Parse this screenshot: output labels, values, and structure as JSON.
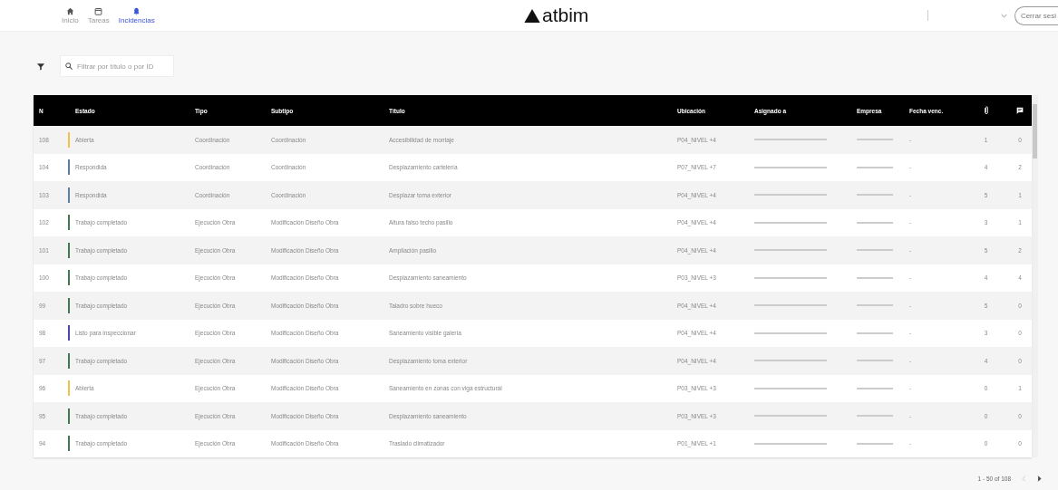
{
  "nav": [
    {
      "label": "Inicio",
      "kind": "home",
      "selected": false
    },
    {
      "label": "Tareas",
      "kind": "calendar",
      "selected": false
    },
    {
      "label": "Incidencias",
      "kind": "bell",
      "selected": true
    }
  ],
  "logo": "atbim",
  "logout": "Cerrar sesi",
  "search": {
    "placeholder": "Filtrar por título o por ID"
  },
  "table": {
    "columns": [
      "N",
      "Estado",
      "Tipo",
      "Subtipo",
      "Título",
      "Ubicación",
      "Asignado a",
      "Empresa",
      "Fecha venc."
    ],
    "rows": [
      {
        "id": "108",
        "status": "Abierta",
        "color": "#f0c24a",
        "type": "Coordinación",
        "subtype": "Coordinación",
        "title": "Accesibilidad de montaje",
        "location": "P04_NIVEL +4",
        "due": "-",
        "files": "1",
        "comments": "0"
      },
      {
        "id": "104",
        "status": "Respondida",
        "color": "#5a7fa6",
        "type": "Coordinación",
        "subtype": "Coordinación",
        "title": "Desplazamiento cartelería",
        "location": "P07_NIVEL +7",
        "due": "-",
        "files": "4",
        "comments": "2"
      },
      {
        "id": "103",
        "status": "Respondida",
        "color": "#5a7fa6",
        "type": "Coordinación",
        "subtype": "Coordinación",
        "title": "Desplazar toma exterior",
        "location": "P04_NIVEL +4",
        "due": "-",
        "files": "5",
        "comments": "1"
      },
      {
        "id": "102",
        "status": "Trabajo completado",
        "color": "#3d7a4e",
        "type": "Ejecución Obra",
        "subtype": "Modificación Diseño Obra",
        "title": "Altura falso techo pasillo",
        "location": "P04_NIVEL +4",
        "due": "-",
        "files": "3",
        "comments": "1"
      },
      {
        "id": "101",
        "status": "Trabajo completado",
        "color": "#3d7a4e",
        "type": "Ejecución Obra",
        "subtype": "Modificación Diseño Obra",
        "title": "Ampliación pasillo",
        "location": "P04_NIVEL +4",
        "due": "-",
        "files": "5",
        "comments": "2"
      },
      {
        "id": "100",
        "status": "Trabajo completado",
        "color": "#3d7a4e",
        "type": "Ejecución Obra",
        "subtype": "Modificación Diseño Obra",
        "title": "Desplazamiento saneamiento",
        "location": "P03_NIVEL +3",
        "due": "-",
        "files": "4",
        "comments": "4"
      },
      {
        "id": "99",
        "status": "Trabajo completado",
        "color": "#3d7a4e",
        "type": "Ejecución Obra",
        "subtype": "Modificación Diseño Obra",
        "title": "Taladro sobre hueco",
        "location": "P04_NIVEL +4",
        "due": "-",
        "files": "5",
        "comments": "0"
      },
      {
        "id": "98",
        "status": "Listo para inspeccionar",
        "color": "#4a3fd4",
        "type": "Ejecución Obra",
        "subtype": "Modificación Diseño Obra",
        "title": "Saneamiento visible galería",
        "location": "P04_NIVEL +4",
        "due": "-",
        "files": "3",
        "comments": "0"
      },
      {
        "id": "97",
        "status": "Trabajo completado",
        "color": "#3d7a4e",
        "type": "Ejecución Obra",
        "subtype": "Modificación Diseño Obra",
        "title": "Desplazamiento toma exterior",
        "location": "P04_NIVEL +4",
        "due": "-",
        "files": "4",
        "comments": "0"
      },
      {
        "id": "96",
        "status": "Abierta",
        "color": "#f0c24a",
        "type": "Ejecución Obra",
        "subtype": "Modificación Diseño Obra",
        "title": "Saneamiento en zonas con viga estructural",
        "location": "P03_NIVEL +3",
        "due": "-",
        "files": "0",
        "comments": "1"
      },
      {
        "id": "95",
        "status": "Trabajo completado",
        "color": "#3d7a4e",
        "type": "Ejecución Obra",
        "subtype": "Modificación Diseño Obra",
        "title": "Desplazamiento saneamiento",
        "location": "P03_NIVEL +3",
        "due": "-",
        "files": "0",
        "comments": "0"
      },
      {
        "id": "94",
        "status": "Trabajo completado",
        "color": "#3d7a4e",
        "type": "Ejecución Obra",
        "subtype": "Modificación Diseño Obra",
        "title": "Traslado climatizador",
        "location": "P01_NIVEL +1",
        "due": "-",
        "files": "0",
        "comments": "0"
      }
    ]
  },
  "pagination": "1 - 50 of 108"
}
